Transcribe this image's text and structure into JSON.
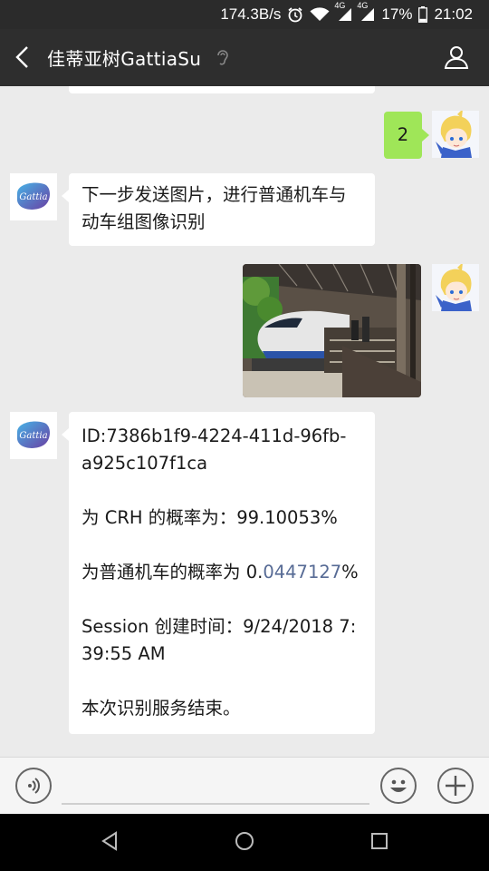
{
  "status_bar": {
    "net_speed": "174.3B/s",
    "network_1": "4G",
    "network_2": "4G",
    "battery": "17%",
    "time": "21:02"
  },
  "header": {
    "title": "佳蒂亚树GattiaSu"
  },
  "messages": {
    "m1": {
      "text": "2"
    },
    "m2": {
      "line1": "下一步发送图片，进行普通机车与",
      "line2": "动车组图像识别"
    },
    "m4": {
      "id_line1": "ID:7386b1f9-4224-411d-96fb-",
      "id_line2": "a925c107f1ca",
      "crh": "为 CRH 的概率为：99.10053%",
      "normal_prefix": "为普通机车的概率为 0.",
      "normal_link": "0447127",
      "normal_suffix": "%",
      "session_line1": "Session 创建时间：9/24/2018 7:",
      "session_line2": "39:55 AM",
      "end": "本次识别服务结束。"
    }
  },
  "avatars": {
    "bot_logo_text": "Gattia"
  },
  "colors": {
    "accent_green": "#9fe658",
    "link_blue": "#576b95",
    "header_bg": "#2e2e2e",
    "chat_bg": "#ebebeb",
    "logo_purple": "#6a3fa3"
  }
}
